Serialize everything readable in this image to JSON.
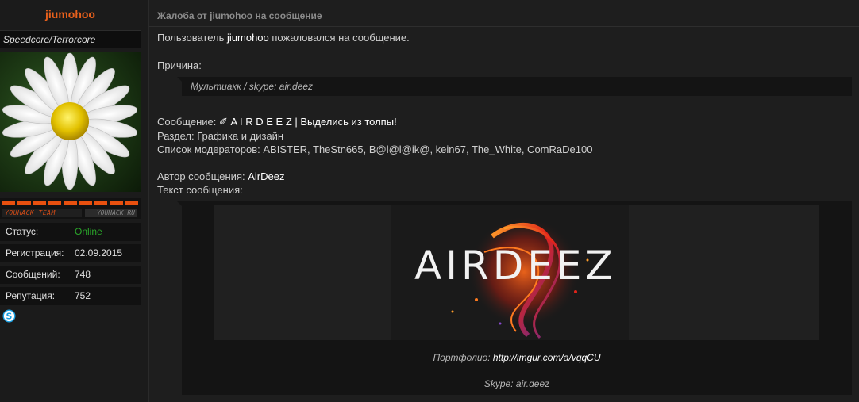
{
  "user": {
    "name": "jiumohoo",
    "title": "Speedcore/Terrorcore",
    "banner_left": "YOUHACK TEAM",
    "banner_right": "YOUHACK.RU",
    "stats": [
      {
        "key": "Статус:",
        "value": "Online"
      },
      {
        "key": "Регистрация:",
        "value": "02.09.2015"
      },
      {
        "key": "Сообщений:",
        "value": "748"
      },
      {
        "key": "Репутация:",
        "value": "752"
      }
    ],
    "skype_icon": "skype-icon",
    "online_color": "#2aa52a",
    "name_color": "#e8601c"
  },
  "report": {
    "heading": "Жалоба от jiumohoo на сообщение",
    "intro_prefix": "Пользователь",
    "intro_user": "jiumohoo",
    "intro_suffix": "пожаловался на сообщение.",
    "reason_label": "Причина:",
    "reason_text": "Мультиакк / skype: air.deez",
    "message_label": "Сообщение:",
    "message_title": "✐ A I R D E E Z | Выделись из толпы!",
    "section_label": "Раздел:",
    "section_value": "Графика и дизайн",
    "mods_label": "Список модераторов:",
    "mods_value": "ABISTER, TheStn665, B@l@l@ik@, kein67, The_White, ComRaDe100",
    "author_label": "Автор сообщения:",
    "author_value": "AirDeez",
    "text_label": "Текст сообщения:"
  },
  "post": {
    "logo_text": "AIRDEEZ",
    "portfolio_label": "Портфолио:",
    "portfolio_link": "http://imgur.com/a/vqqCU",
    "skype_line": "Skype: air.deez"
  }
}
